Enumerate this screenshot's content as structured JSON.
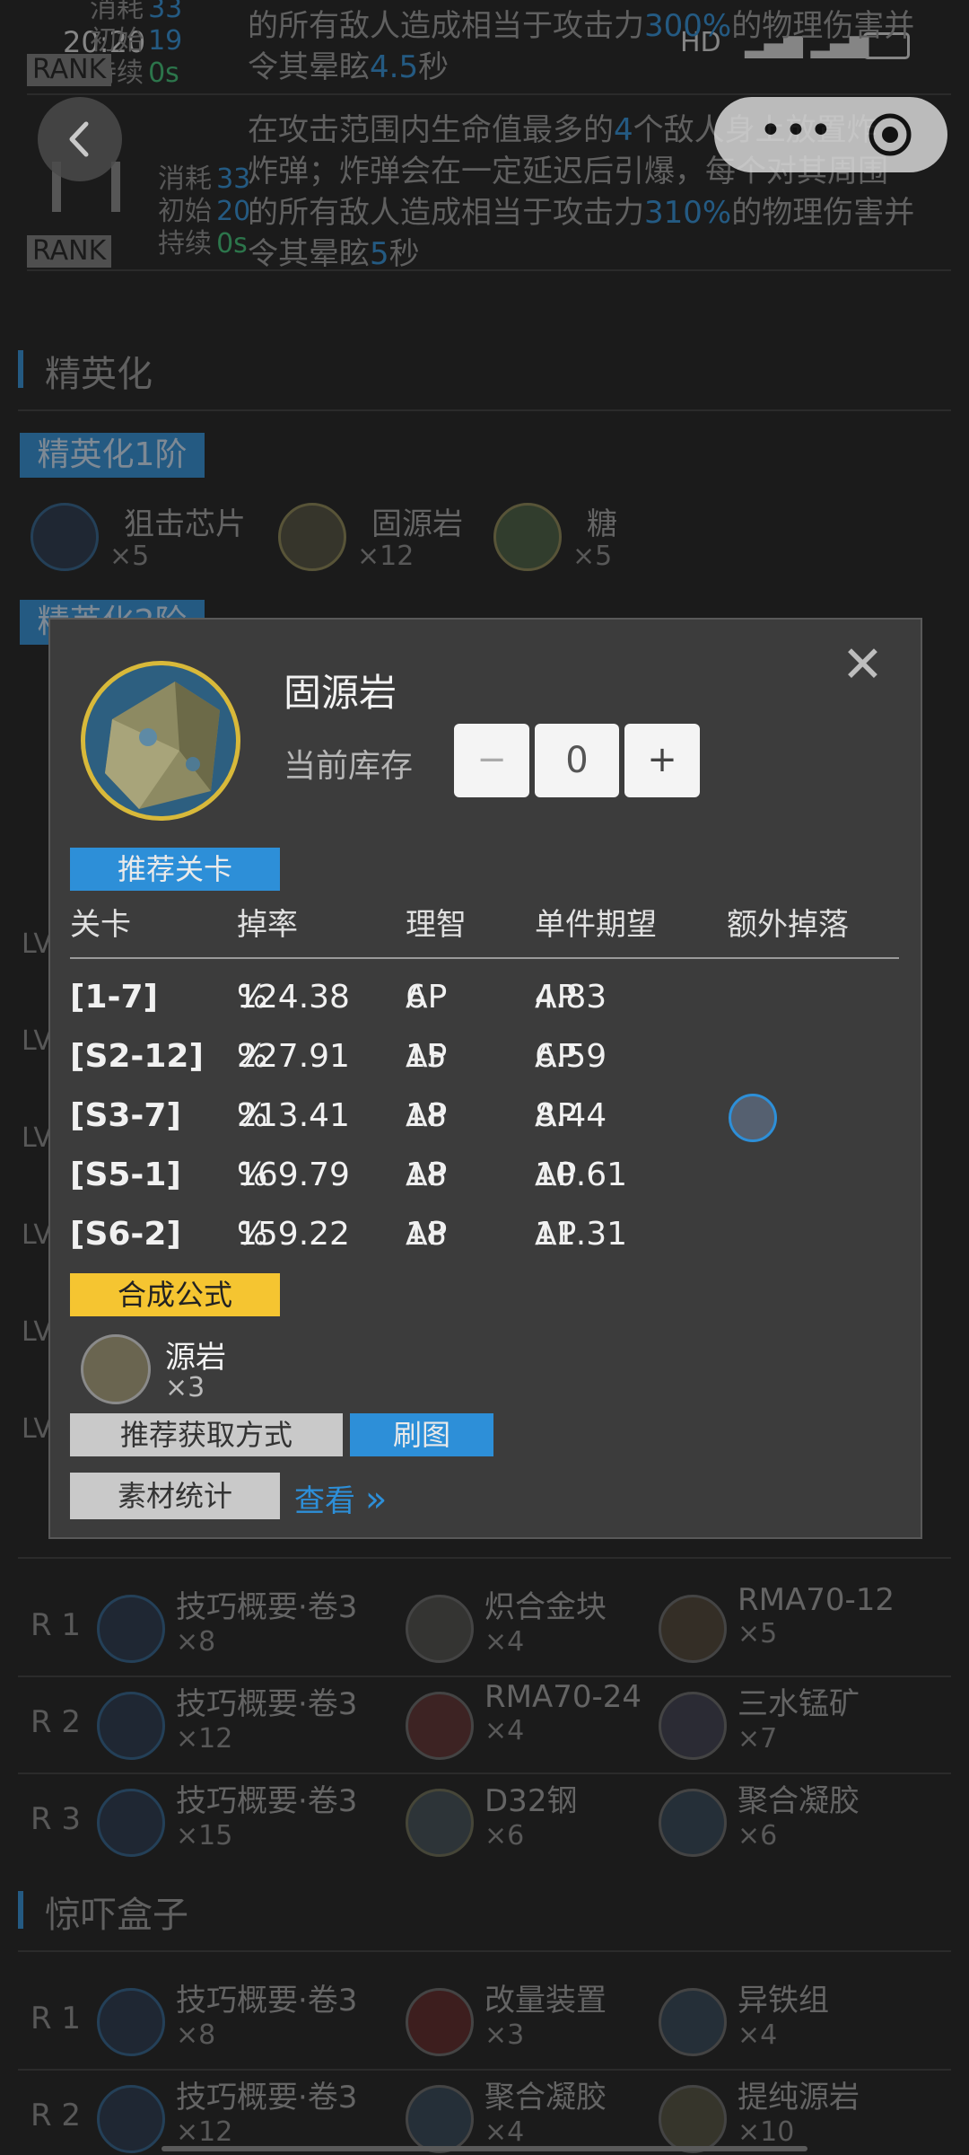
{
  "status_bar": {
    "time": "20:20",
    "net": "HD"
  },
  "skills": [
    {
      "cost_label": "消耗",
      "cost": "33",
      "init_label": "初始",
      "init": "19",
      "dur_label": "持续",
      "dur": "0s",
      "rank": "RANK",
      "text_a": "的所有敌人造成相当于攻击力",
      "pct": "300%",
      "text_b": "的物理伤害并",
      "text_c": "令其晕眩",
      "stun": "4.5",
      "text_d": "秒"
    },
    {
      "cost_label": "消耗",
      "cost": "33",
      "init_label": "初始",
      "init": "20",
      "dur_label": "持续",
      "dur": "0s",
      "rank": "RANK",
      "line1_a": "在攻击范围内生命值最多的",
      "count": "4",
      "line1_b": "个敌人身上放置炸",
      "line2": "炸弹；炸弹会在一定延迟后引爆，每个对其周围",
      "text_a": "的所有敌人造成相当于攻击力",
      "pct": "310%",
      "text_b": "的物理伤害并",
      "text_c": "令其晕眩",
      "stun": "5",
      "text_d": "秒"
    }
  ],
  "elite": {
    "title": "精英化",
    "tier1": "精英化1阶",
    "tier2": "精英化2阶",
    "items": [
      {
        "name": "狙击芯片",
        "qty": "×5"
      },
      {
        "name": "固源岩",
        "qty": "×12"
      },
      {
        "name": "糖",
        "qty": "×5"
      }
    ],
    "lv_label": "LV"
  },
  "skill_mats": {
    "rows": [
      {
        "rank": "R 1",
        "items": [
          {
            "name": "技巧概要·卷3",
            "qty": "×8"
          },
          {
            "name": "炽合金块",
            "qty": "×4"
          },
          {
            "name": "RMA70-12",
            "qty": "×5"
          }
        ]
      },
      {
        "rank": "R 2",
        "items": [
          {
            "name": "技巧概要·卷3",
            "qty": "×12"
          },
          {
            "name": "RMA70-24",
            "qty": "×4"
          },
          {
            "name": "三水锰矿",
            "qty": "×7"
          }
        ]
      },
      {
        "rank": "R 3",
        "items": [
          {
            "name": "技巧概要·卷3",
            "qty": "×15"
          },
          {
            "name": "D32钢",
            "qty": "×6"
          },
          {
            "name": "聚合凝胶",
            "qty": "×6"
          }
        ]
      }
    ]
  },
  "box": {
    "title": "惊吓盒子",
    "rows": [
      {
        "rank": "R 1",
        "items": [
          {
            "name": "技巧概要·卷3",
            "qty": "×8"
          },
          {
            "name": "改量装置",
            "qty": "×3"
          },
          {
            "name": "异铁组",
            "qty": "×4"
          }
        ]
      },
      {
        "rank": "R 2",
        "items": [
          {
            "name": "技巧概要·卷3",
            "qty": "×12"
          },
          {
            "name": "聚合凝胶",
            "qty": "×4"
          },
          {
            "name": "提纯源岩",
            "qty": "×10"
          }
        ]
      }
    ]
  },
  "modal": {
    "item_name": "固源岩",
    "stock_label": "当前库存",
    "stock_value": "0",
    "minus": "−",
    "plus": "+",
    "close": "✕",
    "recommend_tag": "推荐关卡",
    "headers": [
      "关卡",
      "掉率",
      "理智",
      "单件期望",
      "额外掉落"
    ],
    "rows": [
      {
        "stage": "[1-7]",
        "rate": "124.38",
        "ap": "6",
        "expect": "4.83",
        "extra": false
      },
      {
        "stage": "[S2-12]",
        "rate": "227.91",
        "ap": "15",
        "expect": "6.59",
        "extra": false
      },
      {
        "stage": "[S3-7]",
        "rate": "213.41",
        "ap": "18",
        "expect": "8.44",
        "extra": true
      },
      {
        "stage": "[S5-1]",
        "rate": "169.79",
        "ap": "18",
        "expect": "10.61",
        "extra": false
      },
      {
        "stage": "[S6-2]",
        "rate": "159.22",
        "ap": "18",
        "expect": "11.31",
        "extra": false
      }
    ],
    "pct_unit": "%",
    "ap_unit": "AP",
    "formula_tag": "合成公式",
    "formula_item": "源岩",
    "formula_qty": "×3",
    "acquire_btn": "推荐获取方式",
    "farm_btn": "刷图",
    "stats_btn": "素材统计",
    "view_link": "查看",
    "view_arrow": "»"
  },
  "colors": {
    "accent": "#2d8fd8",
    "yellow": "#f5c531",
    "bg": "#1b1b1b",
    "modal": "#3c3c3c"
  }
}
